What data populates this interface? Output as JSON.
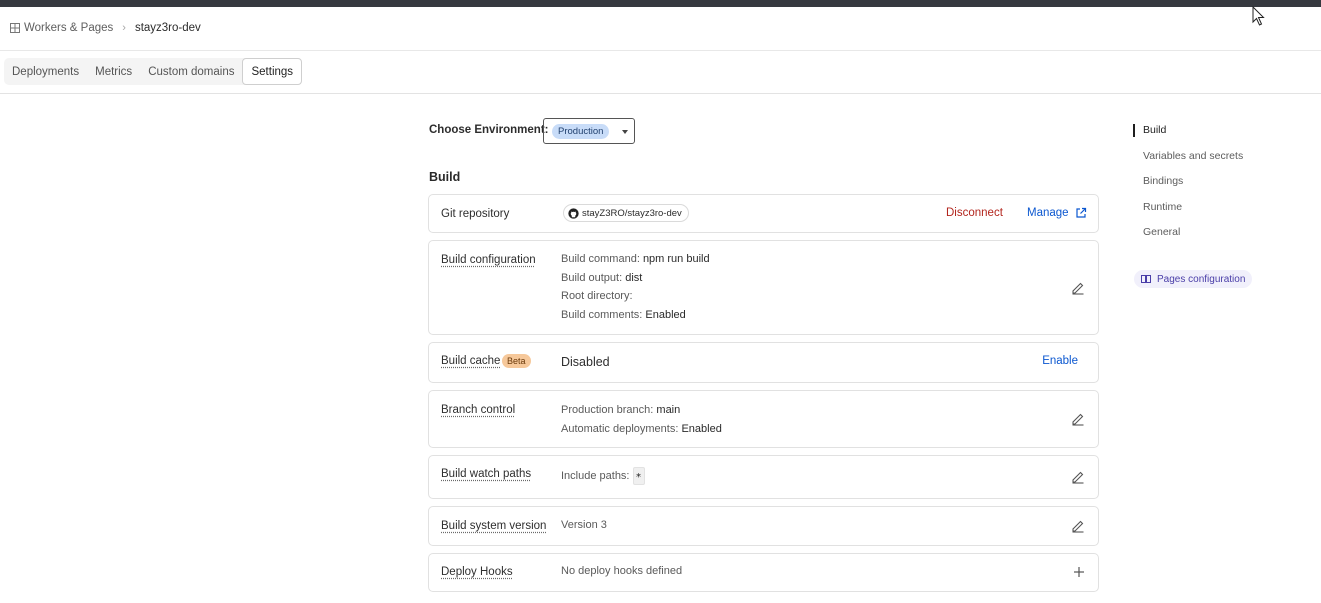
{
  "breadcrumb": {
    "root": "Workers & Pages",
    "separator": "›",
    "current": "stayz3ro-dev"
  },
  "tabs": [
    {
      "label": "Deployments"
    },
    {
      "label": "Metrics"
    },
    {
      "label": "Custom domains"
    },
    {
      "label": "Settings",
      "active": true
    }
  ],
  "environment": {
    "label": "Choose Environment:",
    "selected": "Production"
  },
  "section_title": "Build",
  "git": {
    "label": "Git repository",
    "repo": "stayZ3RO/stayz3ro-dev",
    "disconnect": "Disconnect",
    "manage": "Manage"
  },
  "build_config": {
    "label": "Build configuration",
    "command_key": "Build command:",
    "command_val": "npm run build",
    "output_key": "Build output:",
    "output_val": "dist",
    "root_key": "Root directory:",
    "root_val": "",
    "comments_key": "Build comments:",
    "comments_val": "Enabled"
  },
  "build_cache": {
    "label": "Build cache",
    "badge": "Beta",
    "value": "Disabled",
    "action": "Enable"
  },
  "branch_control": {
    "label": "Branch control",
    "prod_key": "Production branch:",
    "prod_val": "main",
    "auto_key": "Automatic deployments:",
    "auto_val": "Enabled"
  },
  "watch_paths": {
    "label": "Build watch paths",
    "key": "Include paths:",
    "val": "*"
  },
  "system_version": {
    "label": "Build system version",
    "value": "Version 3"
  },
  "deploy_hooks": {
    "label": "Deploy Hooks",
    "value": "No deploy hooks defined"
  },
  "toc": {
    "items": [
      "Build",
      "Variables and secrets",
      "Bindings",
      "Runtime",
      "General"
    ],
    "pages_config": "Pages configuration"
  },
  "colors": {
    "accent_blue": "#0b57d0",
    "danger_red": "#b3261e",
    "beta_orange": "#f6c89a",
    "env_pill": "#c8dcf8"
  }
}
